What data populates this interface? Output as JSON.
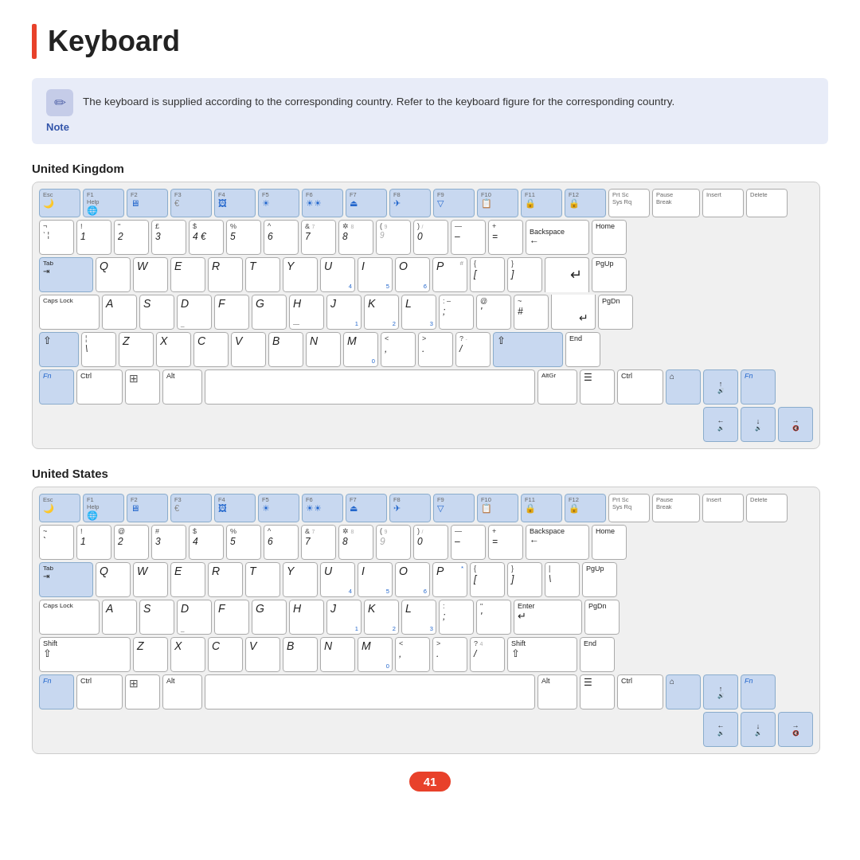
{
  "page": {
    "title": "Keyboard",
    "page_number": "41",
    "note_icon": "✏️",
    "note_text": "The keyboard is supplied according to the corresponding country. Refer to the keyboard figure for the corresponding country.",
    "note_label": "Note",
    "section_uk": "United Kingdom",
    "section_us": "United States"
  }
}
